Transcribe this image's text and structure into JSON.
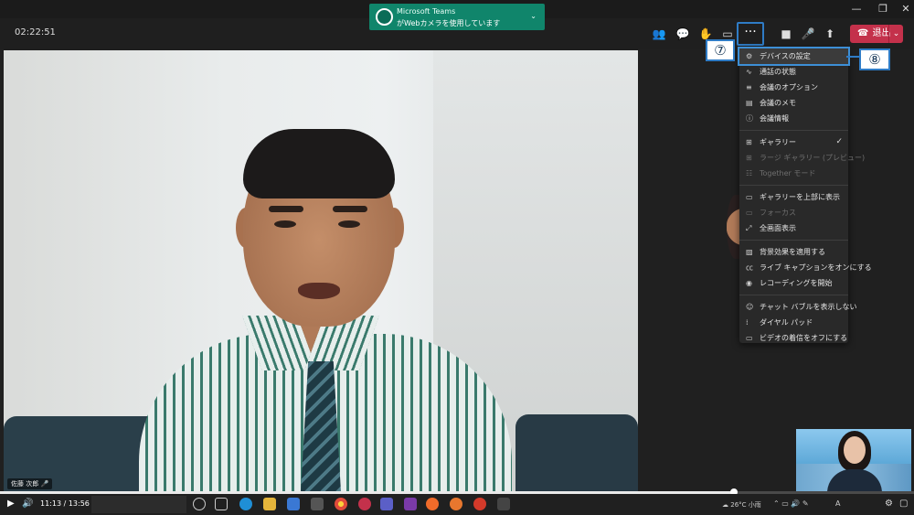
{
  "toast": {
    "title": "Microsoft Teams",
    "body": "がWebカメラを使用しています"
  },
  "header": {
    "timer": "02:22:51",
    "more_label": "···",
    "leave_label": "退出"
  },
  "menu": {
    "items": [
      {
        "label": "デバイスの設定",
        "icon": "gear-icon",
        "state": "highlighted"
      },
      {
        "label": "通話の状態",
        "icon": "pulse-icon"
      },
      {
        "label": "会議のオプション",
        "icon": "sliders-icon"
      },
      {
        "label": "会議のメモ",
        "icon": "notes-icon"
      },
      {
        "label": "会議情報",
        "icon": "info-icon"
      },
      {
        "label": "ギャラリー",
        "icon": "grid-icon",
        "checked": true
      },
      {
        "label": "ラージ ギャラリー (プレビュー)",
        "icon": "large-grid-icon",
        "disabled": true
      },
      {
        "label": "Together モード",
        "icon": "together-icon",
        "disabled": true
      },
      {
        "label": "ギャラリーを上部に表示",
        "icon": "gallery-top-icon"
      },
      {
        "label": "フォーカス",
        "icon": "focus-icon",
        "disabled": true
      },
      {
        "label": "全画面表示",
        "icon": "fullscreen-icon"
      },
      {
        "label": "背景効果を適用する",
        "icon": "background-icon"
      },
      {
        "label": "ライブ キャプションをオンにする",
        "icon": "cc-icon"
      },
      {
        "label": "レコーディングを開始",
        "icon": "record-icon"
      },
      {
        "label": "チャット バブルを表示しない",
        "icon": "chat-bubble-icon"
      },
      {
        "label": "ダイヤル パッド",
        "icon": "dialpad-icon"
      },
      {
        "label": "ビデオの着信をオフにする",
        "icon": "video-off-icon"
      }
    ]
  },
  "callouts": {
    "seven": "⑦",
    "eight": "⑧"
  },
  "video": {
    "speaker_name": "佐藤 次郎"
  },
  "player": {
    "time": "11:13 / 13:56",
    "progress": 0.803
  },
  "tray": {
    "weather": "26°C 小雨",
    "ime": "A"
  },
  "colors": {
    "accent": "#2f7cc6",
    "leave": "#c4314b",
    "toast": "#10856b"
  }
}
